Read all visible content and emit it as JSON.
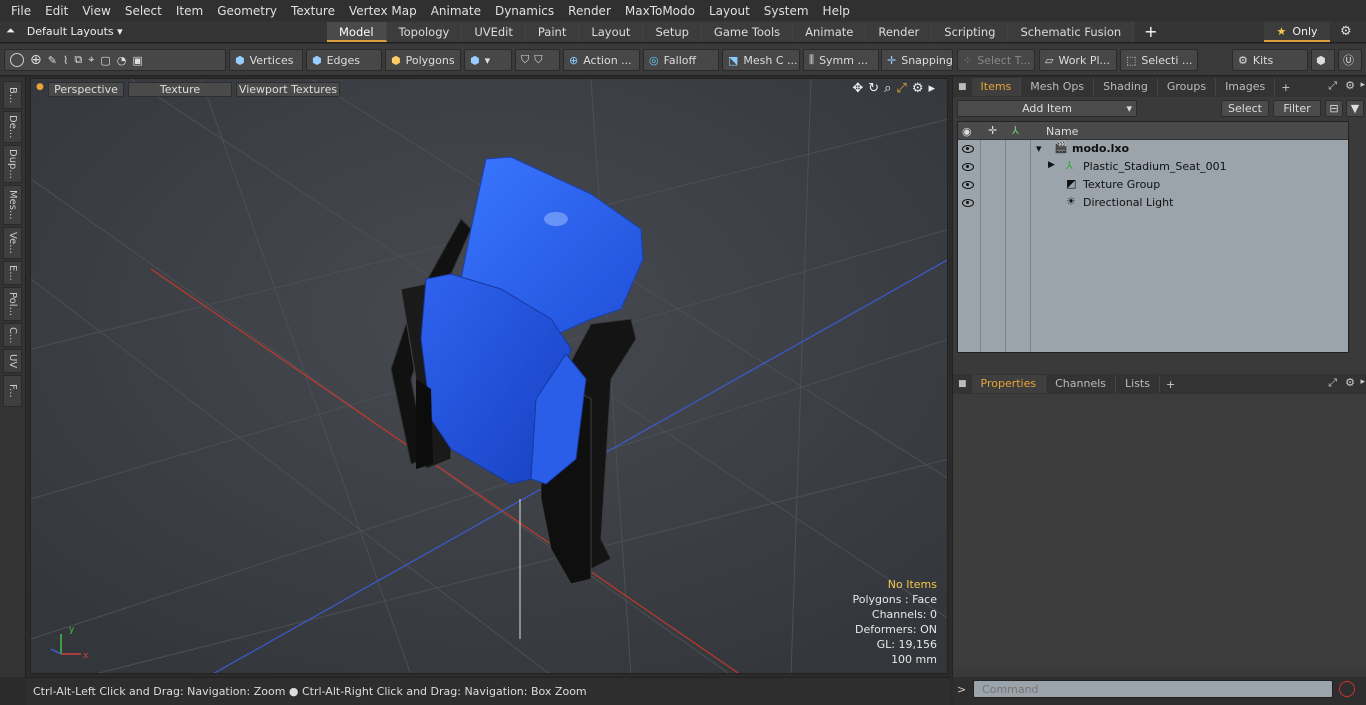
{
  "menu": [
    "File",
    "Edit",
    "View",
    "Select",
    "Item",
    "Geometry",
    "Texture",
    "Vertex Map",
    "Animate",
    "Dynamics",
    "Render",
    "MaxToModo",
    "Layout",
    "System",
    "Help"
  ],
  "layouts_label": "Default Layouts ▾",
  "tabs": [
    "Model",
    "Topology",
    "UVEdit",
    "Paint",
    "Layout",
    "Setup",
    "Game Tools",
    "Animate",
    "Render",
    "Scripting",
    "Schematic Fusion"
  ],
  "only_label": "Only",
  "toolbar": {
    "vertices": "Vertices",
    "edges": "Edges",
    "polygons": "Polygons",
    "action": "Action ...",
    "falloff": "Falloff",
    "mesh": "Mesh C ...",
    "symm": "Symm ...",
    "snapping": "Snapping",
    "select_t": "Select T...",
    "work_pl": "Work Pl...",
    "selecti": "Selecti ...",
    "kits": "Kits"
  },
  "left_tabs": [
    "B...",
    "De...",
    "Dup...",
    "Mes...",
    "Ve...",
    "E...",
    "Pol...",
    "C...",
    "UV",
    "F..."
  ],
  "viewport": {
    "perspective": "Perspective",
    "texture": "Texture",
    "viewport_textures": "Viewport Textures",
    "stats": {
      "no_items": "No Items",
      "polygons": "Polygons : Face",
      "channels": "Channels: 0",
      "deformers": "Deformers: ON",
      "gl": "GL: 19,156",
      "scale": "100 mm"
    }
  },
  "status": "Ctrl-Alt-Left Click and Drag: Navigation: Zoom ● Ctrl-Alt-Right Click and Drag: Navigation: Box Zoom",
  "items_panel": {
    "tabs": [
      "Items",
      "Mesh Ops",
      "Shading",
      "Groups",
      "Images"
    ],
    "add_item": "Add Item",
    "select": "Select",
    "filter": "Filter",
    "name_col": "Name",
    "rows": [
      "modo.lxo",
      "Plastic_Stadium_Seat_001",
      "Texture Group",
      "Directional Light"
    ]
  },
  "props_panel": {
    "tabs": [
      "Properties",
      "Channels",
      "Lists"
    ]
  },
  "command_placeholder": "Command",
  "colors": {
    "accent": "#d9a13b",
    "seat_blue": "#2a5fe0"
  }
}
